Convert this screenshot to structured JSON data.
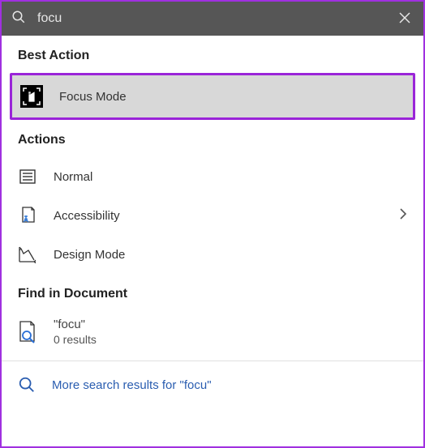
{
  "search": {
    "query": "focu"
  },
  "sections": {
    "best_action": {
      "label": "Best Action",
      "item": {
        "label": "Focus Mode"
      }
    },
    "actions": {
      "label": "Actions",
      "items": [
        {
          "label": "Normal"
        },
        {
          "label": "Accessibility"
        },
        {
          "label": "Design Mode"
        }
      ]
    },
    "find": {
      "label": "Find in Document",
      "query_display": "\"focu\"",
      "result_count": "0 results"
    },
    "more": {
      "label": "More search results for \"focu\""
    }
  }
}
